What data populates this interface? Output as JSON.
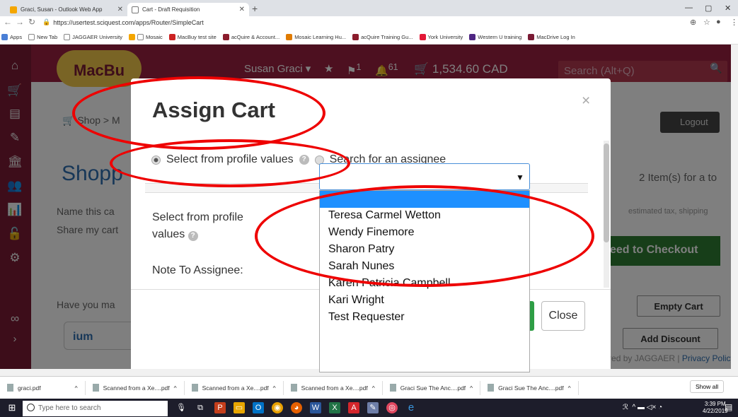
{
  "browser": {
    "tabs": [
      {
        "title": "Graci, Susan - Outlook Web App"
      },
      {
        "title": "Cart - Draft Requisition"
      }
    ],
    "url": "https://usertest.sciquest.com/apps/Router/SimpleCart",
    "bookmarks": [
      "Apps",
      "New Tab",
      "JAGGAER University",
      "Mosaic",
      "MacBuy test site",
      "acQuire & Account...",
      "Mosaic Learning Hu...",
      "acQuire Training Gu...",
      "York University",
      "Western U training",
      "MacDrive Log In"
    ]
  },
  "header": {
    "logo": "MacBu",
    "user": "Susan Graci",
    "flag_count": "1",
    "notif_count": "61",
    "cart_total": "1,534.60 CAD",
    "search_placeholder": "Search (Alt+Q)",
    "logout": "Logout"
  },
  "page": {
    "breadcrumb_shop": "Shop",
    "breadcrumb_next": "M",
    "title": "Shopp",
    "name_cart": "Name this ca",
    "share_cart": "Share my cart",
    "items_summary": "2 Item(s)  for a to",
    "estimated_tax": "estimated tax, shipping",
    "checkout_button": "eed to Checkout",
    "have_you": "Have you ma",
    "empty_cart": "Empty Cart",
    "add_discount": "Add Discount",
    "jump": "ium",
    "powered_by": "Powered by JAGGAER | ",
    "privacy": "Privacy Policy"
  },
  "modal": {
    "title": "Assign Cart",
    "close_x": "×",
    "radio_profile": "Select from profile values",
    "radio_search": "Search for an assignee",
    "field_label_line1": "Select from profile",
    "field_label_line2": "values",
    "note_label": "Note To Assignee:",
    "close_button": "Close"
  },
  "dropdown": {
    "selected": "",
    "options": [
      "",
      "Teresa Carmel Wetton",
      "Wendy Finemore",
      "Sharon Patry",
      "Sarah Nunes",
      "Karen Patricia Campbell",
      "Kari Wright",
      "Test Requester"
    ]
  },
  "downloads": {
    "items": [
      "graci.pdf",
      "Scanned from a Xe....pdf",
      "Scanned from a Xe....pdf",
      "Scanned from a Xe....pdf",
      "Graci Sue The Anc....pdf",
      "Graci Sue The Anc....pdf"
    ],
    "show_all": "Show all"
  },
  "taskbar": {
    "search_placeholder": "Type here to search",
    "time": "3:39 PM",
    "date": "4/22/2019"
  },
  "colors": {
    "brand_maroon": "#9b2040",
    "sidebar": "#7a1a34",
    "annotation_red": "#e00000",
    "highlight_blue": "#1e90ff",
    "checkout_green": "#2e7d32"
  }
}
